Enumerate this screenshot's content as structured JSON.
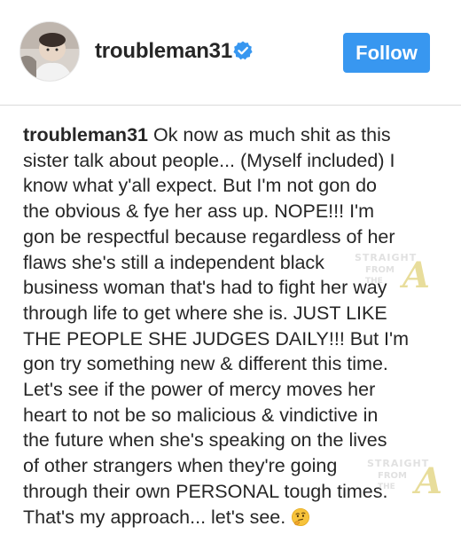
{
  "post": {
    "username": "troubleman31",
    "follow_label": "Follow",
    "verified_icon": "verified-badge-icon",
    "accent_color": "#3897f0"
  },
  "caption": {
    "author": "troubleman31",
    "lines": [
      "Ok now as much shit as this",
      "sister talk about people... (Myself included) I",
      "know what y'all expect. But I'm not gon do",
      "the obvious & fye her ass up. NOPE!!! I'm",
      "gon be respectful because regardless of her",
      "flaws she's still a independent black",
      "business woman that's had to fight her way",
      "through life to get where she is. JUST LIKE",
      "THE PEOPLE SHE JUDGES DAILY!!! But I'm",
      "gon try something new & different this time.",
      "Let's see if the power of mercy moves her",
      "heart to not be so malicious & vindictive in",
      "the future when she's speaking on the lives",
      "of other strangers when they're going",
      "through their own PERSONAL tough times.",
      "That's my approach... let's see."
    ],
    "emoji": "thinking-face-icon"
  },
  "watermark": {
    "line1": "STRAIGHT",
    "line2": "FROM",
    "line3": "THE",
    "letter": "A"
  }
}
